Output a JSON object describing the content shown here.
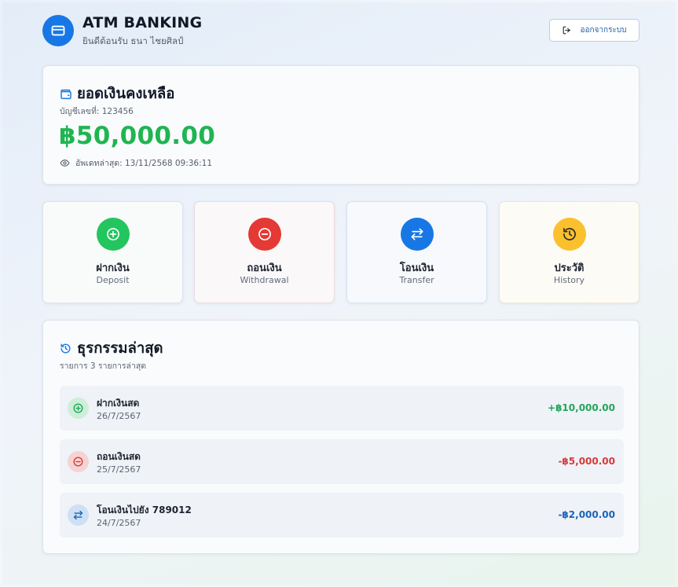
{
  "header": {
    "title": "ATM BANKING",
    "welcome": "ยินดีต้อนรับ ธนา ไชยศิลป์",
    "logout_label": "ออกจากระบบ"
  },
  "balance": {
    "title": "ยอดเงินคงเหลือ",
    "account": "บัญชีเลขที่: 123456",
    "amount": "฿50,000.00",
    "updated": "อัพเดทล่าสุด: 13/11/2568 09:36:11"
  },
  "actions": [
    {
      "label_th": "ฝากเงิน",
      "label_en": "Deposit",
      "icon": "plus-circle-icon",
      "color": "#22c55e"
    },
    {
      "label_th": "ถอนเงิน",
      "label_en": "Withdrawal",
      "icon": "minus-circle-icon",
      "color": "#e53935"
    },
    {
      "label_th": "โอนเงิน",
      "label_en": "Transfer",
      "icon": "swap-arrows-icon",
      "color": "#1677e5"
    },
    {
      "label_th": "ประวัติ",
      "label_en": "History",
      "icon": "history-icon",
      "color": "#fbc02d"
    }
  ],
  "recent": {
    "title": "ธุรกรรมล่าสุด",
    "subtitle": "รายการ 3 รายการล่าสุด",
    "items": [
      {
        "title": "ฝากเงินสด",
        "date": "26/7/2567",
        "amount": "+฿10,000.00",
        "icon": "plus-circle-icon",
        "color": "#22a65a"
      },
      {
        "title": "ถอนเงินสด",
        "date": "25/7/2567",
        "amount": "-฿5,000.00",
        "icon": "minus-circle-icon",
        "color": "#d83a3a"
      },
      {
        "title": "โอนเงินไปยัง 789012",
        "date": "24/7/2567",
        "amount": "-฿2,000.00",
        "icon": "swap-arrows-icon",
        "color": "#1c64b8"
      }
    ]
  },
  "colors": {
    "brand": "#1677e5",
    "balance_green": "#20b552"
  }
}
